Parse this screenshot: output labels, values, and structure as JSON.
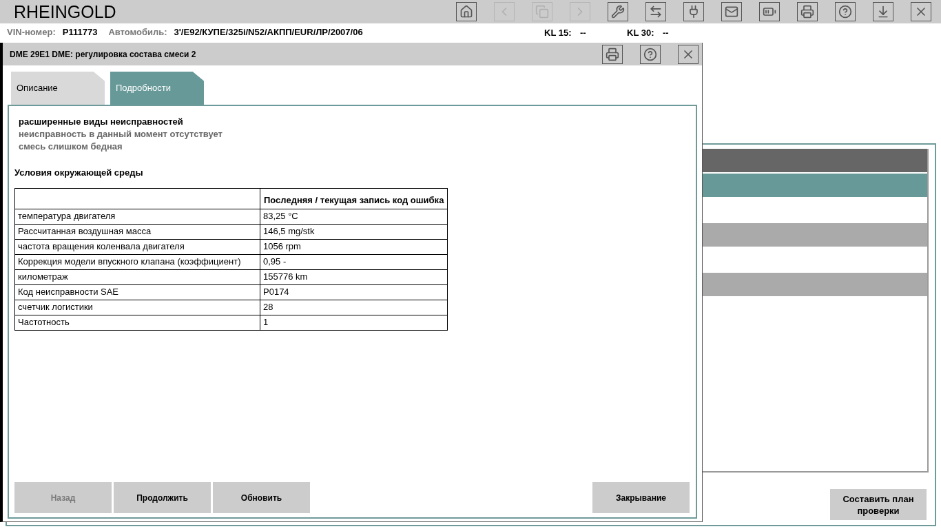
{
  "app": {
    "title": "RHEINGOLD"
  },
  "toolbar": [
    {
      "kind": "home",
      "disabled": false
    },
    {
      "kind": "back",
      "disabled": true
    },
    {
      "kind": "copy",
      "disabled": true
    },
    {
      "kind": "forward",
      "disabled": true
    },
    {
      "kind": "wrench",
      "disabled": false
    },
    {
      "kind": "swap",
      "disabled": false
    },
    {
      "kind": "plug",
      "disabled": false
    },
    {
      "kind": "mail",
      "disabled": false
    },
    {
      "kind": "battery",
      "disabled": false
    },
    {
      "kind": "print",
      "disabled": false
    },
    {
      "kind": "help",
      "disabled": false
    },
    {
      "kind": "dropdown",
      "disabled": false
    },
    {
      "kind": "close",
      "disabled": false
    }
  ],
  "vehicle_bar": {
    "vin_label": "VIN-номер:",
    "vin": "P111773",
    "car_label": "Автомобиль:",
    "car": "3'/E92/КУПЕ/325i/N52/АКПП/EUR/ЛР/2007/06",
    "kl15_label": "KL 15:",
    "kl15": "--",
    "kl30_label": "KL 30:",
    "kl30": "--"
  },
  "background_panel": {
    "rows": [
      {
        "kind": "header"
      },
      {
        "kind": "selected"
      },
      {
        "kind": "plain"
      },
      {
        "kind": "shaded"
      },
      {
        "kind": "plain"
      },
      {
        "kind": "shaded"
      }
    ],
    "button": "Составить план проверки"
  },
  "dialog": {
    "title": "DME 29E1 DME: регулировка состава смеси 2",
    "title_buttons": [
      {
        "kind": "print"
      },
      {
        "kind": "help"
      },
      {
        "kind": "close"
      }
    ],
    "tabs": [
      {
        "label": "Описание",
        "selected": false
      },
      {
        "label": "Подробности",
        "selected": true
      }
    ],
    "fault_heading": "расширенные виды неисправностей",
    "fault_lines": [
      "неисправность в данный момент отсутствует",
      "смесь слишком бедная"
    ],
    "conditions_heading": "Условия окружающей среды",
    "table": {
      "columns": [
        "",
        "Последняя / текущая запись код ошибка"
      ],
      "rows": [
        [
          "температура двигателя",
          "83,25 °C"
        ],
        [
          "Рассчитанная воздушная масса",
          "146,5 mg/stk"
        ],
        [
          "частота вращения коленвала двигателя",
          "1056 rpm"
        ],
        [
          "Коррекция модели впускного клапана (коэффициент)",
          "0,95 -"
        ],
        [
          "километраж",
          "155776 km"
        ],
        [
          "Код неисправности SAE",
          "P0174"
        ],
        [
          "счетчик логистики",
          "28"
        ],
        [
          "Частотность",
          "1"
        ]
      ]
    },
    "buttons": [
      {
        "label": "Назад",
        "disabled": true
      },
      {
        "label": "Продолжить",
        "disabled": false
      },
      {
        "label": "Обновить",
        "disabled": false
      }
    ],
    "close_button": {
      "label": "Закрывание",
      "disabled": false
    }
  }
}
